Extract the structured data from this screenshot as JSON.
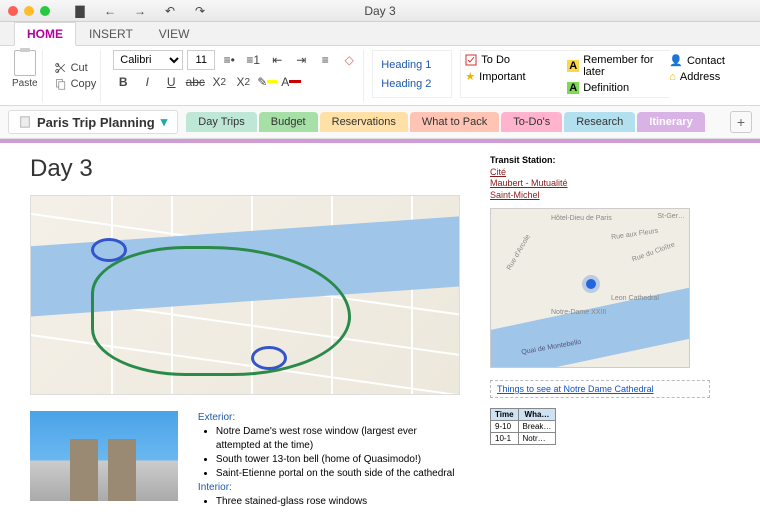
{
  "window": {
    "title": "Day 3"
  },
  "menu": {
    "tabs": [
      "HOME",
      "INSERT",
      "VIEW"
    ],
    "active": 0
  },
  "ribbon": {
    "paste": "Paste",
    "cut": "Cut",
    "copy": "Copy",
    "font": "Calibri",
    "size": "11",
    "headings": [
      "Heading 1",
      "Heading 2"
    ],
    "tags": [
      {
        "icon": "checkbox",
        "label": "To Do"
      },
      {
        "icon": "star",
        "label": "Important"
      },
      {
        "icon": "A-yellow",
        "label": "Remember for later"
      },
      {
        "icon": "A-green",
        "label": "Definition"
      },
      {
        "icon": "person",
        "label": "Contact"
      },
      {
        "icon": "house",
        "label": "Address"
      }
    ]
  },
  "notebook": {
    "name": "Paris Trip Planning"
  },
  "sections": [
    {
      "label": "Day Trips",
      "color": "#bfe7d6"
    },
    {
      "label": "Budget",
      "color": "#a6e0a6"
    },
    {
      "label": "Reservations",
      "color": "#ffe0a6"
    },
    {
      "label": "What to Pack",
      "color": "#ffc4b3"
    },
    {
      "label": "To-Do's",
      "color": "#ffb3cc"
    },
    {
      "label": "Research",
      "color": "#b3e0ef"
    },
    {
      "label": "Itinerary",
      "color": "#d9b3e6",
      "active": true
    }
  ],
  "page_title": "Day 3",
  "transit": {
    "header": "Transit Station:",
    "stations": [
      "Cité",
      "Maubert - Mutualité",
      "Saint-Michel"
    ]
  },
  "thingstosee": "Things to see at Notre Dame Cathedral",
  "exterior": {
    "header": "Exterior:",
    "items": [
      "Notre Dame's west rose window (largest ever attempted at the time)",
      "South tower 13-ton bell (home of Quasimodo!)",
      "Saint-Etienne portal on the south side of the cathedral"
    ]
  },
  "interior": {
    "header": "Interior:",
    "items": [
      "Three stained-glass rose windows"
    ]
  },
  "map2labels": {
    "a": "Hôtel-Dieu de Paris",
    "b": "Leon Cathedral",
    "c": "Rue d'Arcole",
    "d": "Rue du Cloître",
    "e": "Quai de Montebello",
    "f": "St-Ger…",
    "g": "Notre-Dame XXIII",
    "h": "Rue aux Fleurs"
  },
  "sched": {
    "headers": [
      "Time",
      "Wha…"
    ],
    "rows": [
      [
        "9-10",
        "Break…"
      ],
      [
        "10-1",
        "Notr…"
      ]
    ]
  }
}
